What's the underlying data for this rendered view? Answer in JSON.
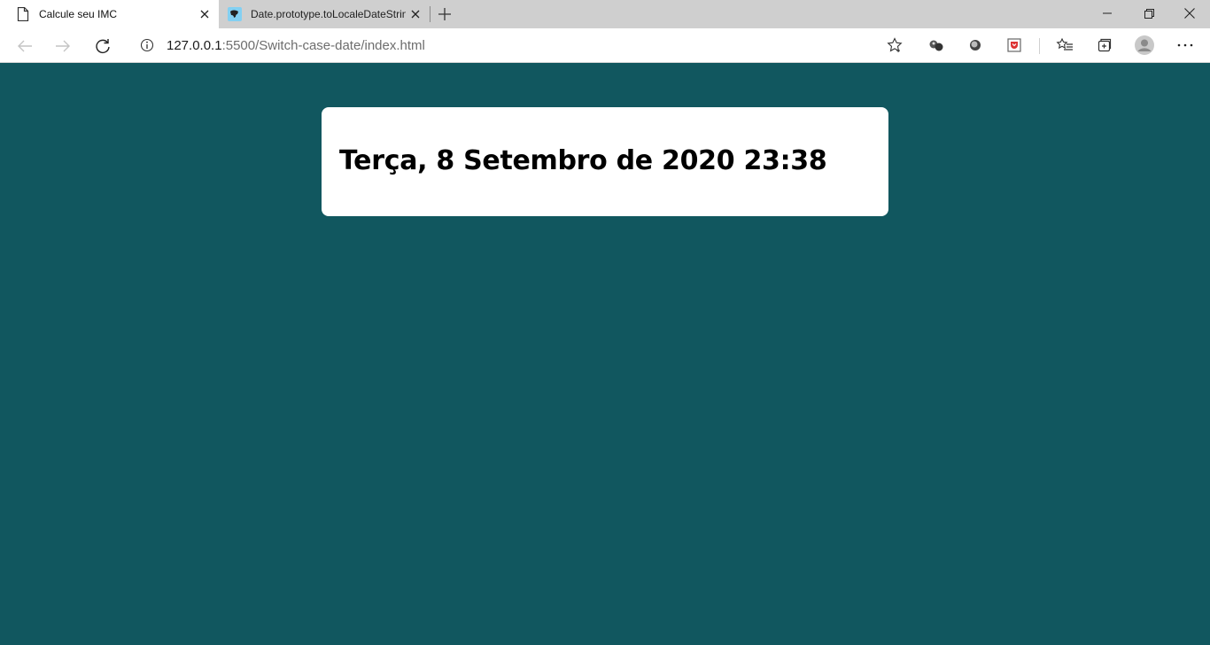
{
  "tabs": [
    {
      "title": "Calcule seu IMC",
      "active": true
    },
    {
      "title": "Date.prototype.toLocaleDateString()",
      "active": false
    }
  ],
  "window_controls": {
    "minimize": "minimize-icon",
    "restore": "restore-icon",
    "close": "close-icon"
  },
  "address_bar": {
    "host": "127.0.0.1",
    "path": ":5500/Switch-case-date/index.html"
  },
  "page": {
    "date_text": "Terça, 8 Setembro de 2020 23:38"
  },
  "colors": {
    "page_background": "#11575f",
    "card_background": "#ffffff",
    "tabstrip": "#cfcfcf"
  }
}
